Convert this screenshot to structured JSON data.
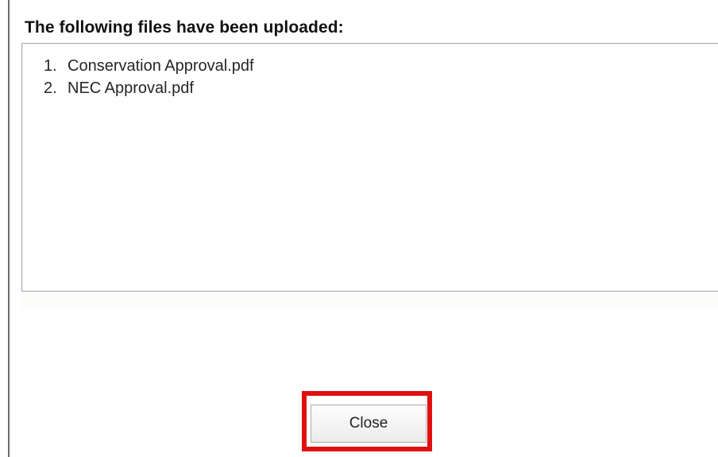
{
  "dialog": {
    "heading": "The following files have been uploaded:",
    "files": [
      {
        "number": "1.",
        "name": "Conservation Approval.pdf"
      },
      {
        "number": "2.",
        "name": "NEC Approval.pdf"
      }
    ],
    "close_label": "Close"
  },
  "colors": {
    "highlight": "#e01010",
    "border": "#a9a9a9"
  }
}
